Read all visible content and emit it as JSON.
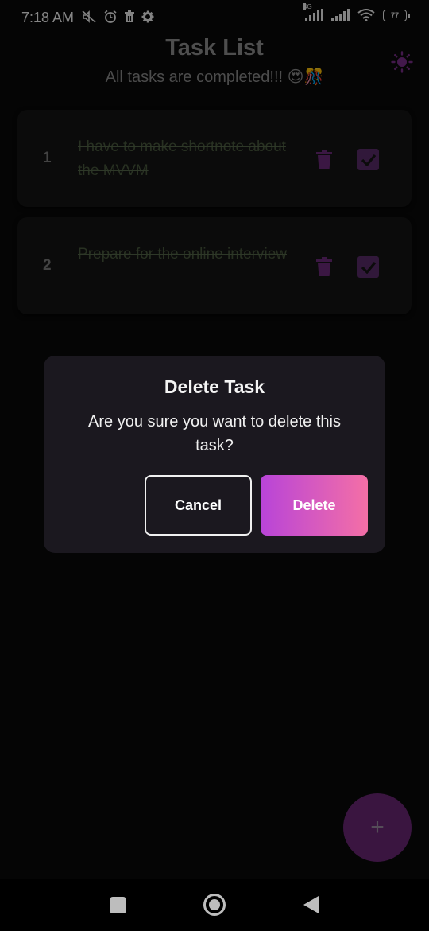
{
  "status_bar": {
    "time": "7:18 AM",
    "left_icons": [
      "mute-icon",
      "alarm-icon",
      "trash-notification-icon",
      "settings-notification-icon"
    ],
    "network_label": "4G",
    "battery": "77"
  },
  "header": {
    "title": "Task List",
    "subtitle": "All tasks are completed!!! 😍🎊",
    "theme_icon": "sun-icon"
  },
  "tasks": [
    {
      "number": "1",
      "text": "I have to make shortnote about the MVVM",
      "completed": true
    },
    {
      "number": "2",
      "text": "Prepare for the online interview",
      "completed": true
    }
  ],
  "dialog": {
    "title": "Delete Task",
    "message": "Are you sure you want to delete this task?",
    "cancel_label": "Cancel",
    "delete_label": "Delete"
  },
  "fab": {
    "label": "+"
  },
  "colors": {
    "background": "#0a0a0a",
    "card": "#141414",
    "accent_purple": "#6b2775",
    "gradient_start": "#b844d8",
    "gradient_end": "#f46fa6",
    "completed_text": "#4a5a3e"
  }
}
